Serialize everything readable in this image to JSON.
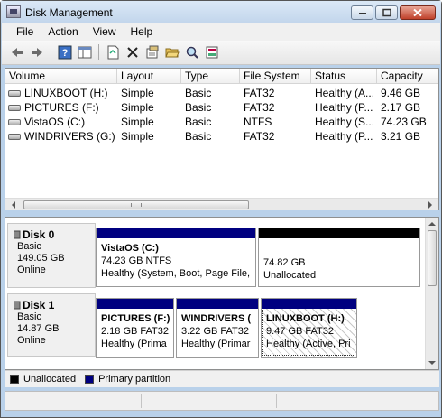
{
  "window": {
    "title": "Disk Management"
  },
  "menu": [
    "File",
    "Action",
    "View",
    "Help"
  ],
  "toolbar": {
    "buttons": [
      {
        "icon": "back-arrow-icon"
      },
      {
        "icon": "forward-arrow-icon"
      },
      {
        "icon": "help-icon"
      },
      {
        "icon": "show-hide-pane-icon"
      },
      {
        "icon": "properties-icon"
      },
      {
        "icon": "delete-icon"
      },
      {
        "icon": "properties-sheet-icon"
      },
      {
        "icon": "open-folder-icon"
      },
      {
        "icon": "search-icon"
      },
      {
        "icon": "export-list-icon"
      }
    ]
  },
  "volumes": {
    "columns": [
      "Volume",
      "Layout",
      "Type",
      "File System",
      "Status",
      "Capacity"
    ],
    "rows": [
      {
        "volume": "LINUXBOOT (H:)",
        "layout": "Simple",
        "type": "Basic",
        "fs": "FAT32",
        "status": "Healthy (A...",
        "capacity": "9.46 GB"
      },
      {
        "volume": "PICTURES (F:)",
        "layout": "Simple",
        "type": "Basic",
        "fs": "FAT32",
        "status": "Healthy (P...",
        "capacity": "2.17 GB"
      },
      {
        "volume": "VistaOS (C:)",
        "layout": "Simple",
        "type": "Basic",
        "fs": "NTFS",
        "status": "Healthy (S...",
        "capacity": "74.23 GB"
      },
      {
        "volume": "WINDRIVERS (G:)",
        "layout": "Simple",
        "type": "Basic",
        "fs": "FAT32",
        "status": "Healthy (P...",
        "capacity": "3.21 GB"
      }
    ]
  },
  "disks": [
    {
      "name": "Disk 0",
      "type": "Basic",
      "size": "149.05 GB",
      "state": "Online",
      "partitions": [
        {
          "name": "VistaOS  (C:)",
          "line1": "74.23 GB NTFS",
          "line2": "Healthy (System, Boot, Page File,",
          "kind": "primary"
        },
        {
          "name": "",
          "line1": "74.82 GB",
          "line2": "Unallocated",
          "kind": "unallocated"
        }
      ]
    },
    {
      "name": "Disk 1",
      "type": "Basic",
      "size": "14.87 GB",
      "state": "Online",
      "partitions": [
        {
          "name": "PICTURES  (F:)",
          "line1": "2.18 GB FAT32",
          "line2": "Healthy (Prima",
          "kind": "primary"
        },
        {
          "name": "WINDRIVERS  (",
          "line1": "3.22 GB FAT32",
          "line2": "Healthy (Primar",
          "kind": "primary"
        },
        {
          "name": "LINUXBOOT  (H:)",
          "line1": "9.47 GB FAT32",
          "line2": "Healthy (Active, Pri",
          "kind": "primary"
        }
      ]
    }
  ],
  "legend": [
    {
      "label": "Unallocated",
      "color": "#000000"
    },
    {
      "label": "Primary partition",
      "color": "#000080"
    }
  ],
  "colors": {
    "primary": "#000080",
    "unallocated": "#000000"
  }
}
